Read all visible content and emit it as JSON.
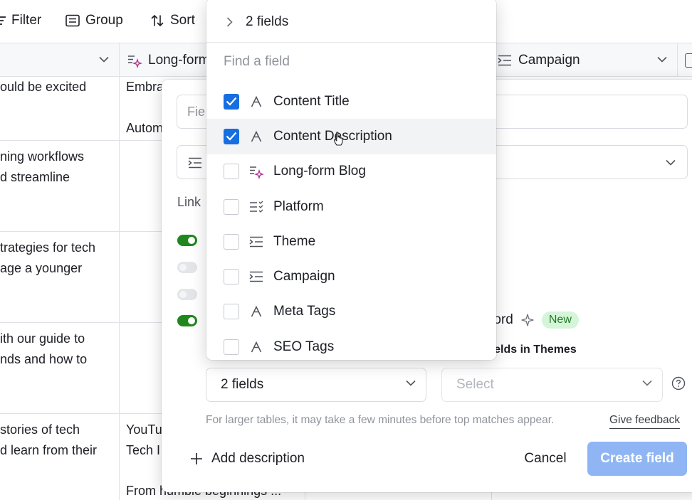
{
  "toolbar": {
    "filter_label": "Filter",
    "group_label": "Group",
    "sort_label": "Sort"
  },
  "grid": {
    "columns": [
      "",
      "Long-form Blog",
      "Campaign"
    ],
    "cells": {
      "col1": [
        [
          "ould be excited"
        ],
        [
          "ning workflows",
          "d streamline"
        ],
        [
          "trategies for tech",
          "age a younger"
        ],
        [
          "ith our guide to",
          "nds and how to"
        ],
        [
          "stories of tech",
          "d learn from their"
        ]
      ],
      "col2": [
        [
          "Embra",
          "",
          "Autom"
        ],
        [],
        [],
        [],
        [
          "YouTu",
          "Tech I",
          "",
          "From humble beginnings ..."
        ]
      ]
    }
  },
  "dialog": {
    "name_placeholder": "Fie",
    "link_label": "Link",
    "match_label": "record",
    "new_badge": "New",
    "fields_subheading": "e fields in Themes",
    "fields_selected": "2 fields",
    "select_placeholder": "Select",
    "note": "For larger tables, it may take a few minutes before top matches appear.",
    "feedback_link": "Give feedback",
    "add_description": "Add description",
    "cancel": "Cancel",
    "create": "Create field",
    "toggles": [
      true,
      false,
      false,
      true
    ]
  },
  "popover": {
    "header": "2 fields",
    "search_placeholder": "Find a field",
    "items": [
      {
        "label": "Content Title",
        "checked": true,
        "icon": "single-line-text-icon"
      },
      {
        "label": "Content Description",
        "checked": true,
        "icon": "single-line-text-icon"
      },
      {
        "label": "Long-form Blog",
        "checked": false,
        "icon": "ai-long-text-icon"
      },
      {
        "label": "Platform",
        "checked": false,
        "icon": "multiple-select-icon"
      },
      {
        "label": "Theme",
        "checked": false,
        "icon": "link-record-icon"
      },
      {
        "label": "Campaign",
        "checked": false,
        "icon": "link-record-icon"
      },
      {
        "label": "Meta Tags",
        "checked": false,
        "icon": "single-line-text-icon"
      },
      {
        "label": "SEO Tags",
        "checked": false,
        "icon": "single-line-text-icon"
      }
    ]
  },
  "colors": {
    "accent": "#166ee1",
    "toggle_on": "#20871e",
    "create_button": "#8fb5f4",
    "new_badge_bg": "#d5f5d8",
    "ai_icon": "#b02d8b"
  }
}
